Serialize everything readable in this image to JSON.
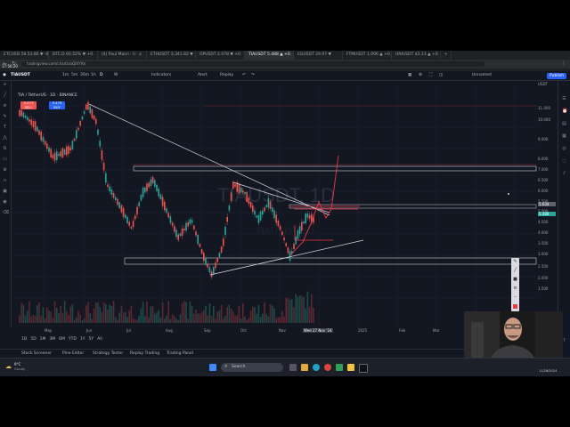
{
  "browser": {
    "tabs": [
      "ETCUSD 58.53.86 ▼ -0.",
      "BTC.D 60.52% ▼ +0.",
      "(4) Paul Mann · li · a",
      "ETHUSDT 3,341.82 ▼",
      "OPUSDT 2.078 ▼ +0.",
      "TIAUSDT 5.488 ▲ +0.",
      "EGUSDT 29.97 ▼",
      "FTMUSDT 1.096 ▲ +0.",
      "UNIUSDT 43.13 ▲ +0."
    ],
    "active_tab_index": 5,
    "url": "tradingview.com/chart/xaQIXYYo/",
    "top_left_readout": "17:56:20"
  },
  "toolbar": {
    "symbol": "TIAUSDT",
    "intervals": [
      "1m",
      "5m",
      "30m",
      "1h",
      "D",
      "W"
    ],
    "indicators_label": "Indicators",
    "alert_label": "Alert",
    "replay_label": "Replay",
    "unnamed_label": "Unnamed",
    "publish_label": "Publish"
  },
  "chart": {
    "legend_line": "TIA / TetherUS · 1D · BINANCE",
    "sell_price": "5.477",
    "sell_label": "SELL",
    "buy_price": "5.479",
    "buy_label": "BUY",
    "watermark": "TIAUSDT, 1D",
    "watermark_sub": "TIAUSDT, 1D",
    "price_labels": [
      "11.000",
      "10.000",
      "9.000",
      "8.000",
      "7.000",
      "6.500",
      "6.000",
      "5.500",
      "5.000",
      "4.500",
      "4.000",
      "3.500",
      "3.000",
      "2.500",
      "2.000",
      "1.500"
    ],
    "time_labels": [
      "May",
      "Jun",
      "Jul",
      "Aug",
      "Sep",
      "Oct",
      "Nov",
      "Wed 27 Nov '24",
      "2025",
      "Feb",
      "Mar"
    ],
    "current_price_tag": "5.488",
    "crosshair_price_tag": "5.634",
    "axis_currency": "USDT",
    "accent_colors": {
      "up": "#26a69a",
      "down": "#ef5350",
      "drawing_red": "#f23645",
      "trendline": "#cfd3dc",
      "zone": "#d1d4dc"
    }
  },
  "bottom": {
    "timeframes": [
      "1D",
      "5D",
      "1M",
      "3M",
      "6M",
      "YTD",
      "1Y",
      "5Y",
      "All"
    ],
    "panels": [
      "Stock Screener",
      "Pine Editor",
      "Strategy Tester",
      "Replay Trading",
      "Trading Panel"
    ]
  },
  "taskbar": {
    "weather_temp": "9°C",
    "weather_desc": "Cloudy",
    "search_placeholder": "Search",
    "clock_date": "11/26/2024"
  },
  "icons": {
    "left_tools": [
      "crosshair-icon",
      "trendline-icon",
      "fib-icon",
      "brush-icon",
      "text-icon",
      "pattern-icon",
      "prediction-icon",
      "ruler-icon",
      "zoom-icon",
      "magnet-icon",
      "lock-icon",
      "eye-icon",
      "trash-icon"
    ],
    "right_tools": [
      "watchlist-icon",
      "alerts-icon",
      "news-icon",
      "calendar-icon",
      "ideas-icon",
      "chat-icon",
      "notifications-icon",
      "help-icon"
    ],
    "draw_palette": [
      "pencil-icon",
      "line-icon",
      "color-icon",
      "width-icon",
      "style-icon",
      "more-icon"
    ]
  }
}
